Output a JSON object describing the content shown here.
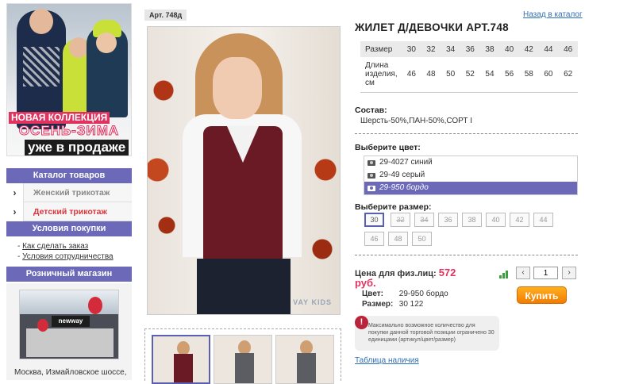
{
  "sidebar": {
    "promo": {
      "line1": "НОВАЯ КОЛЛЕКЦИЯ",
      "line2": "ОСЕНЬ-ЗИМА",
      "line3": "уже в продаже"
    },
    "catalog_header": "Каталог товаров",
    "catalog_items": [
      {
        "label": "Женский трикотаж",
        "arrow": "›"
      },
      {
        "label": "Детский трикотаж",
        "arrow": "›"
      }
    ],
    "conditions_header": "Условия покупки",
    "conditions_links": [
      "Как сделать заказ",
      "Условия сотрудничества"
    ],
    "store_header": "Розничный магазин",
    "store_sign": "newway",
    "store_address": "Москва, Измайловское шоссе,"
  },
  "product": {
    "art_label": "Арт. 748д",
    "back_link": "Назад в каталог",
    "title": "ЖИЛЕТ Д/ДЕВОЧКИ АРТ.748",
    "watermark": "VAY KIDS",
    "size_table": {
      "row1_header": "Размер",
      "row1": [
        "30",
        "32",
        "34",
        "36",
        "38",
        "40",
        "42",
        "44",
        "46"
      ],
      "row2_header": "Длина изделия, см",
      "row2": [
        "46",
        "48",
        "50",
        "52",
        "54",
        "56",
        "58",
        "60",
        "62"
      ]
    },
    "composition_label": "Состав:",
    "composition_value": "Шерсть-50%,ПАН-50%,СОРТ I",
    "color_label": "Выберите цвет:",
    "colors": [
      {
        "label": "29-4027 синий",
        "selected": false
      },
      {
        "label": "29-49 серый",
        "selected": false
      },
      {
        "label": "29-950 бордо",
        "selected": true
      }
    ],
    "size_label": "Выберите размер:",
    "sizes": [
      {
        "label": "30",
        "state": "active"
      },
      {
        "label": "32",
        "state": "na"
      },
      {
        "label": "34",
        "state": "na"
      },
      {
        "label": "36",
        "state": "normal"
      },
      {
        "label": "38",
        "state": "normal"
      },
      {
        "label": "40",
        "state": "normal"
      },
      {
        "label": "42",
        "state": "normal"
      },
      {
        "label": "44",
        "state": "normal"
      },
      {
        "label": "46",
        "state": "normal"
      },
      {
        "label": "48",
        "state": "normal"
      },
      {
        "label": "50",
        "state": "normal"
      }
    ],
    "price_label": "Цена для физ.лиц:",
    "price_value": "572",
    "price_currency": "руб.",
    "selected_color_label": "Цвет:",
    "selected_color_value": "29-950 бордо",
    "selected_size_label": "Размер:",
    "selected_size_value": "30 122",
    "quantity": "1",
    "qty_minus": "‹",
    "qty_plus": "›",
    "buy_label": "Купить",
    "notice_icon": "!",
    "notice_text": "Максимально возможное количество для покупки данной торговой позиции ограничено 30 единицами (артикул/цвет/размер)",
    "stock_link": "Таблица наличия"
  },
  "colors": {
    "accent": "#6b69b8",
    "price": "#e0335f",
    "link": "#2f6fb8",
    "buy": "#f27c00"
  }
}
